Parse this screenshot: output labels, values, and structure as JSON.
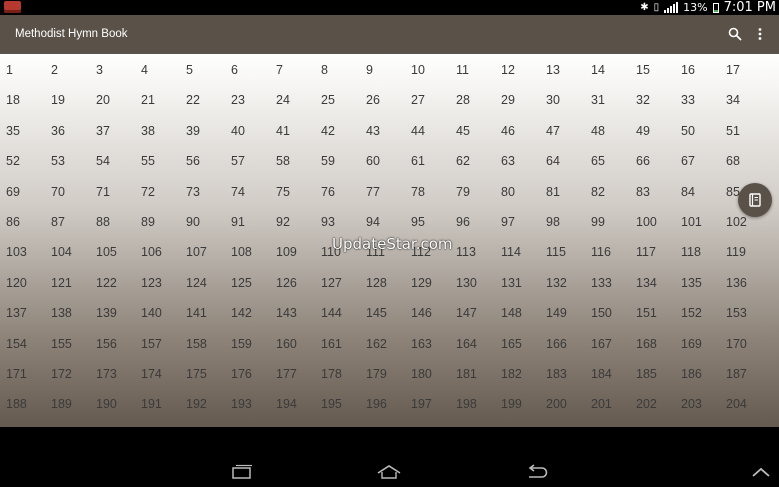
{
  "status_bar": {
    "battery_percent": "13%",
    "time": "7:01 PM"
  },
  "action_bar": {
    "title": "Methodist Hymn Book"
  },
  "hymn_grid": {
    "first": 1,
    "last": 204,
    "columns": 17
  },
  "watermark": "UpdateStar.com",
  "icons": {
    "app": "hymn-book-icon",
    "search": "search-icon",
    "overflow": "more-vert-icon",
    "fab": "book-icon",
    "nav_recent": "recent-apps-icon",
    "nav_home": "home-icon",
    "nav_back": "back-icon",
    "nav_hide": "chevron-up-icon"
  }
}
